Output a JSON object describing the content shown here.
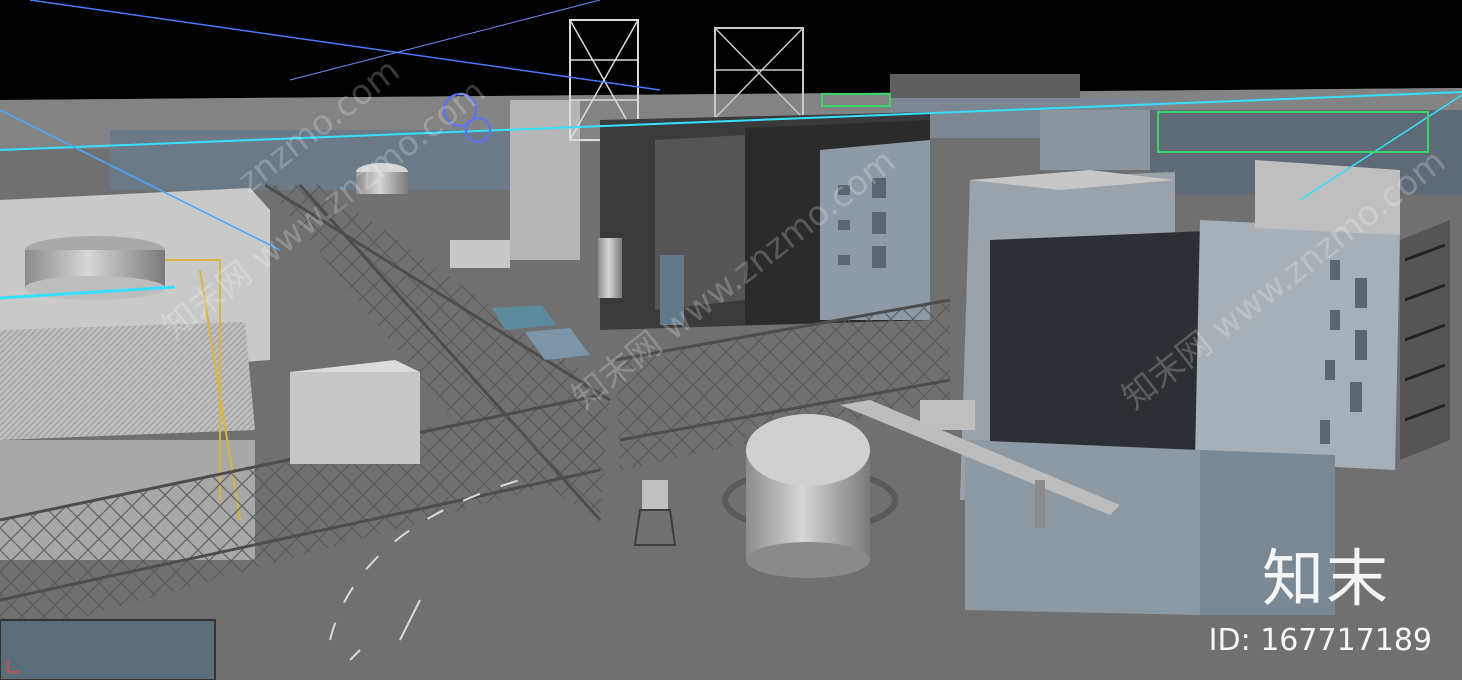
{
  "scene": {
    "description_icon": "industrial-plant-3d-viewport",
    "background_color": "#000000",
    "ground_color": "#6f6f6f",
    "wire_color_cyan": "#35e0ff",
    "wire_color_blue": "#4a7bff",
    "wire_color_green": "#39d46a"
  },
  "watermark": {
    "brand": "知末",
    "id_label": "ID: 167717189",
    "diagonal_texts": [
      "知末网 www.znzmo.com",
      "知末网 www.znzmo.com",
      "znzmo.com",
      "知末网 www.znzmo.com"
    ]
  }
}
